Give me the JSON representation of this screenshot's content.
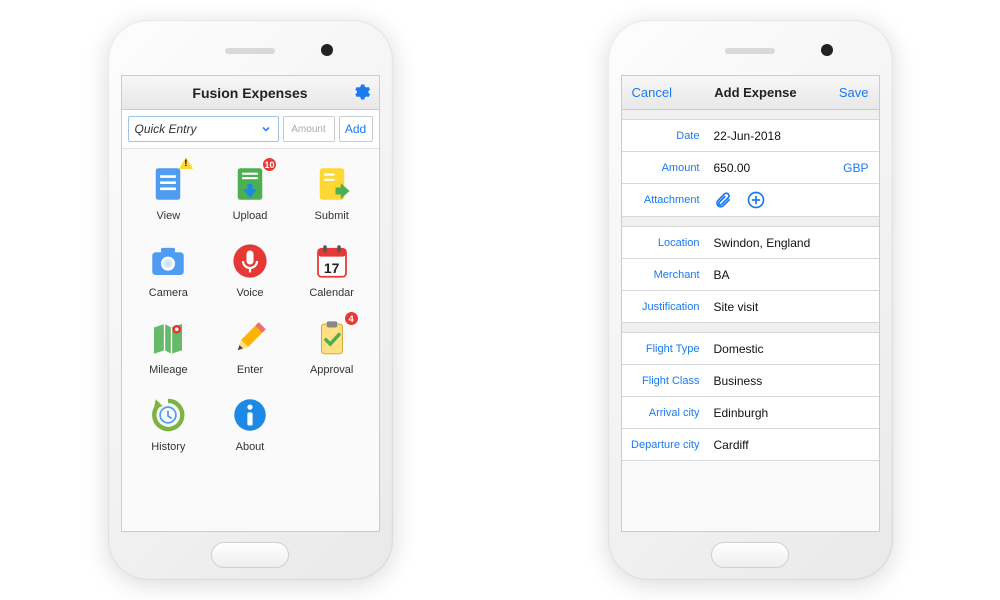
{
  "home": {
    "title": "Fusion Expenses",
    "quick_entry_label": "Quick Entry",
    "amount_placeholder": "Amount",
    "add_label": "Add",
    "apps": {
      "view": {
        "label": "View"
      },
      "upload": {
        "label": "Upload",
        "badge": "10"
      },
      "submit": {
        "label": "Submit"
      },
      "camera": {
        "label": "Camera"
      },
      "voice": {
        "label": "Voice"
      },
      "calendar": {
        "label": "Calendar",
        "day": "17"
      },
      "mileage": {
        "label": "Mileage"
      },
      "enter": {
        "label": "Enter"
      },
      "approval": {
        "label": "Approval",
        "badge": "4"
      },
      "history": {
        "label": "History"
      },
      "about": {
        "label": "About"
      }
    }
  },
  "form": {
    "cancel": "Cancel",
    "title": "Add Expense",
    "save": "Save",
    "labels": {
      "date": "Date",
      "amount": "Amount",
      "attachment": "Attachment",
      "location": "Location",
      "merchant": "Merchant",
      "justification": "Justification",
      "flight_type": "Flight Type",
      "flight_class": "Flight Class",
      "arrival": "Arrival city",
      "departure": "Departure city"
    },
    "values": {
      "date": "22-Jun-2018",
      "amount": "650.00",
      "currency": "GBP",
      "location": "Swindon, England",
      "merchant": "BA",
      "justification": "Site visit",
      "flight_type": "Domestic",
      "flight_class": "Business",
      "arrival": "Edinburgh",
      "departure": "Cardiff"
    }
  }
}
